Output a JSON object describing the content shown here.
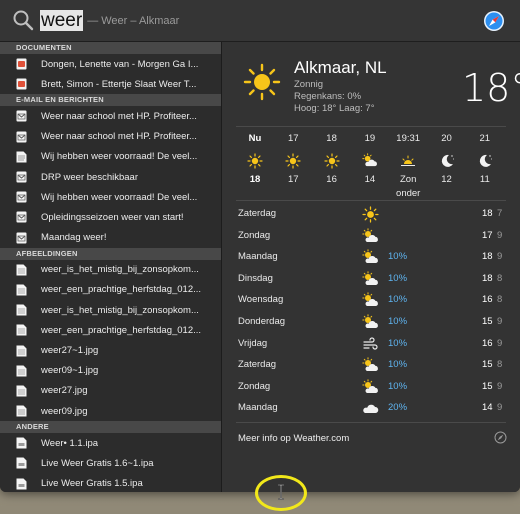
{
  "search": {
    "query": "weer",
    "hint": "— Weer – Alkmaar"
  },
  "results": {
    "sections": [
      {
        "header": "DOCUMENTEN",
        "items": [
          {
            "label": "Dongen, Lenette van - Morgen Ga I...",
            "icon": "pdf-icon"
          },
          {
            "label": "Brett, Simon - Ettertje Slaat Weer T...",
            "icon": "pdf-icon"
          }
        ]
      },
      {
        "header": "E-MAIL EN BERICHTEN",
        "items": [
          {
            "label": "Weer naar school met HP. Profiteer...",
            "icon": "mail-icon"
          },
          {
            "label": "Weer naar school met HP. Profiteer...",
            "icon": "mail-icon"
          },
          {
            "label": "Wij hebben weer voorraad! De veel...",
            "icon": "document-icon"
          },
          {
            "label": "DRP weer beschikbaar",
            "icon": "mail-icon"
          },
          {
            "label": "Wij hebben weer voorraad! De veel...",
            "icon": "mail-icon"
          },
          {
            "label": "Opleidingsseizoen weer van start!",
            "icon": "mail-icon"
          },
          {
            "label": "Maandag weer!",
            "icon": "mail-icon"
          }
        ]
      },
      {
        "header": "AFBEELDINGEN",
        "items": [
          {
            "label": "weer_is_het_mistig_bij_zonsopkom...",
            "icon": "image-file-icon"
          },
          {
            "label": "weer_een_prachtige_herfstdag_012...",
            "icon": "image-file-icon"
          },
          {
            "label": "weer_is_het_mistig_bij_zonsopkom...",
            "icon": "image-file-icon"
          },
          {
            "label": "weer_een_prachtige_herfstdag_012...",
            "icon": "image-file-icon"
          },
          {
            "label": "weer27~1.jpg",
            "icon": "image-file-icon"
          },
          {
            "label": "weer09~1.jpg",
            "icon": "image-file-icon"
          },
          {
            "label": "weer27.jpg",
            "icon": "image-file-icon"
          },
          {
            "label": "weer09.jpg",
            "icon": "image-file-icon"
          }
        ]
      },
      {
        "header": "ANDERE",
        "items": [
          {
            "label": "Weer• 1.1.ipa",
            "icon": "file-icon"
          },
          {
            "label": "Live Weer Gratis 1.6~1.ipa",
            "icon": "file-icon"
          },
          {
            "label": "Live Weer Gratis 1.5.ipa",
            "icon": "file-icon"
          }
        ]
      }
    ]
  },
  "weather": {
    "city": "Alkmaar, NL",
    "condition": "Zonnig",
    "rain_chance": "Regenkans: 0%",
    "high_low": "Hoog: 18°  Laag: 7°",
    "current_temp": "18°",
    "hourly": [
      {
        "label": "Nu",
        "icon": "sun-icon",
        "temp": "18",
        "bold": true
      },
      {
        "label": "17",
        "icon": "sun-icon",
        "temp": "17",
        "bold": false
      },
      {
        "label": "18",
        "icon": "sun-icon",
        "temp": "16",
        "bold": false
      },
      {
        "label": "19",
        "icon": "partly-cloudy-icon",
        "temp": "14",
        "bold": false
      },
      {
        "label": "19:31",
        "icon": "sunset-icon",
        "temp": "Zon onder",
        "bold": false
      },
      {
        "label": "20",
        "icon": "moon-icon",
        "temp": "12",
        "bold": false
      },
      {
        "label": "21",
        "icon": "moon-icon",
        "temp": "11",
        "bold": false
      }
    ],
    "daily": [
      {
        "day": "Zaterdag",
        "icon": "sun-icon",
        "precip": "",
        "high": "18",
        "low": "7"
      },
      {
        "day": "Zondag",
        "icon": "partly-cloudy-icon",
        "precip": "",
        "high": "17",
        "low": "9"
      },
      {
        "day": "Maandag",
        "icon": "partly-cloudy-icon",
        "precip": "10%",
        "high": "18",
        "low": "9"
      },
      {
        "day": "Dinsdag",
        "icon": "partly-cloudy-icon",
        "precip": "10%",
        "high": "18",
        "low": "8"
      },
      {
        "day": "Woensdag",
        "icon": "partly-cloudy-icon",
        "precip": "10%",
        "high": "16",
        "low": "8"
      },
      {
        "day": "Donderdag",
        "icon": "partly-cloudy-icon",
        "precip": "10%",
        "high": "15",
        "low": "9"
      },
      {
        "day": "Vrijdag",
        "icon": "wind-icon",
        "precip": "10%",
        "high": "16",
        "low": "9"
      },
      {
        "day": "Zaterdag",
        "icon": "partly-cloudy-icon",
        "precip": "10%",
        "high": "15",
        "low": "8"
      },
      {
        "day": "Zondag",
        "icon": "partly-cloudy-icon",
        "precip": "10%",
        "high": "15",
        "low": "9"
      },
      {
        "day": "Maandag",
        "icon": "cloud-icon",
        "precip": "20%",
        "high": "14",
        "low": "9"
      }
    ],
    "more_info": "Meer info op Weather.com"
  },
  "colors": {
    "accent_blue": "#5fb4f0",
    "sun_yellow": "#f7c51a",
    "highlight_ring": "#f2e81a"
  }
}
